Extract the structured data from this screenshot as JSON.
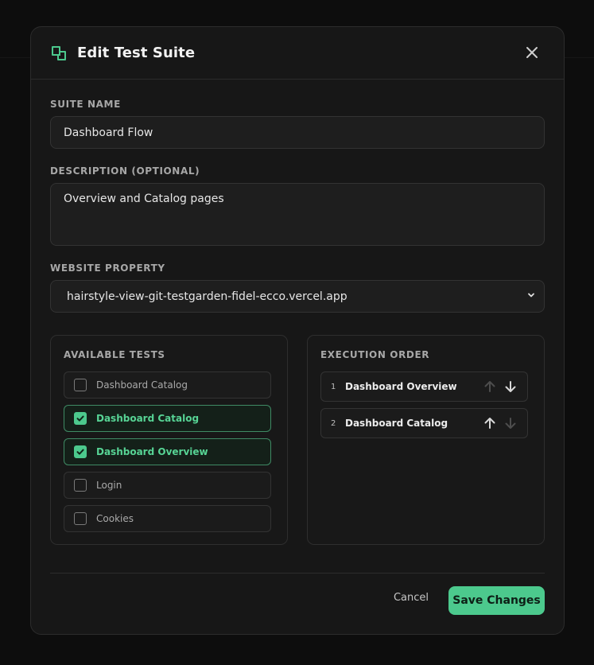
{
  "modal": {
    "title": "Edit Test Suite",
    "icon": "suite-icon",
    "close_icon": "close-icon"
  },
  "form": {
    "suite_name": {
      "label": "SUITE NAME",
      "value": "Dashboard Flow"
    },
    "description": {
      "label": "DESCRIPTION (OPTIONAL)",
      "value": "Overview and Catalog pages"
    },
    "website_property": {
      "label": "WEBSITE PROPERTY",
      "value": "hairstyle-view-git-testgarden-fidel-ecco.vercel.app"
    }
  },
  "available_tests": {
    "title": "AVAILABLE TESTS",
    "items": [
      {
        "name": "Dashboard Catalog",
        "checked": false
      },
      {
        "name": "Dashboard Catalog",
        "checked": true
      },
      {
        "name": "Dashboard Overview",
        "checked": true
      },
      {
        "name": "Login",
        "checked": false
      },
      {
        "name": "Cookies",
        "checked": false
      }
    ]
  },
  "execution_order": {
    "title": "EXECUTION ORDER",
    "items": [
      {
        "index": "1",
        "name": "Dashboard Overview",
        "up_enabled": false,
        "down_enabled": true
      },
      {
        "index": "2",
        "name": "Dashboard Catalog",
        "up_enabled": true,
        "down_enabled": false
      }
    ]
  },
  "footer": {
    "cancel_label": "Cancel",
    "save_label": "Save Changes"
  },
  "colors": {
    "accent": "#4cc98d",
    "modal_bg": "#171717",
    "page_bg": "#0d0d0d"
  }
}
